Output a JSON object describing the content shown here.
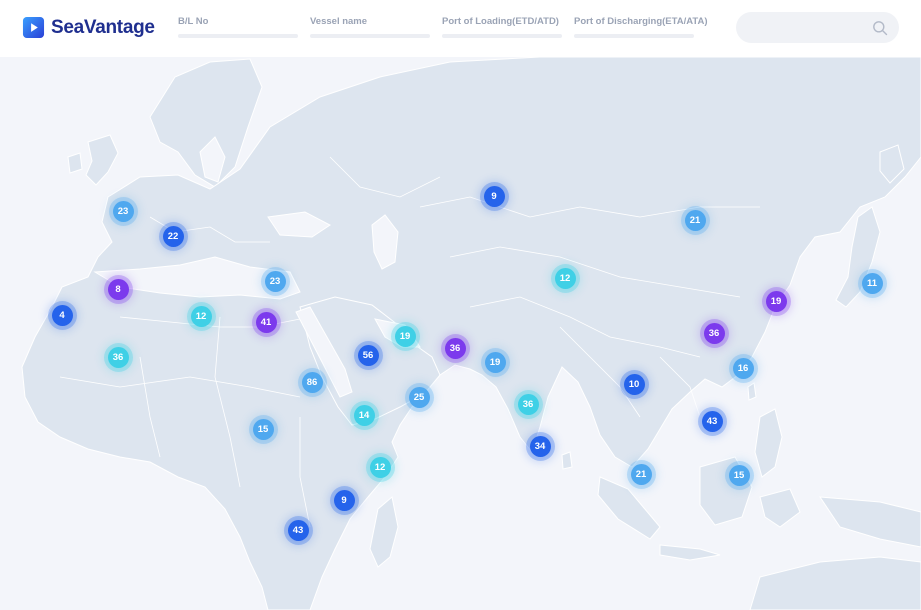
{
  "brand": {
    "name": "SeaVantage",
    "logo_icon": "play-icon"
  },
  "filters": [
    {
      "label": "B/L No"
    },
    {
      "label": "Vessel name"
    },
    {
      "label": "Port of Loading(ETD/ATD)"
    },
    {
      "label": "Port of Discharging(ETA/ATA)"
    }
  ],
  "search": {
    "icon": "search-icon"
  },
  "colors": {
    "blue": "#2563eb",
    "sky": "#4fa8ef",
    "cyan": "#3fd0e6",
    "purple": "#7c3aed",
    "land": "#dde5ef",
    "sea": "#f3f5fa"
  },
  "clusters": [
    {
      "count": "23",
      "color": "sky"
    },
    {
      "count": "22",
      "color": "blue"
    },
    {
      "count": "8",
      "color": "purple"
    },
    {
      "count": "4",
      "color": "blue"
    },
    {
      "count": "36",
      "color": "cyan"
    },
    {
      "count": "12",
      "color": "cyan"
    },
    {
      "count": "23",
      "color": "sky"
    },
    {
      "count": "41",
      "color": "purple"
    },
    {
      "count": "9",
      "color": "blue"
    },
    {
      "count": "12",
      "color": "cyan"
    },
    {
      "count": "21",
      "color": "sky"
    },
    {
      "count": "19",
      "color": "purple"
    },
    {
      "count": "11",
      "color": "sky"
    },
    {
      "count": "19",
      "color": "cyan"
    },
    {
      "count": "56",
      "color": "blue"
    },
    {
      "count": "36",
      "color": "purple"
    },
    {
      "count": "19",
      "color": "sky"
    },
    {
      "count": "36",
      "color": "purple"
    },
    {
      "count": "16",
      "color": "sky"
    },
    {
      "count": "86",
      "color": "sky"
    },
    {
      "count": "25",
      "color": "sky"
    },
    {
      "count": "14",
      "color": "cyan"
    },
    {
      "count": "36",
      "color": "cyan"
    },
    {
      "count": "10",
      "color": "blue"
    },
    {
      "count": "15",
      "color": "sky"
    },
    {
      "count": "34",
      "color": "blue"
    },
    {
      "count": "43",
      "color": "blue"
    },
    {
      "count": "12",
      "color": "cyan"
    },
    {
      "count": "21",
      "color": "sky"
    },
    {
      "count": "15",
      "color": "sky"
    },
    {
      "count": "9",
      "color": "blue"
    },
    {
      "count": "43",
      "color": "blue"
    }
  ]
}
